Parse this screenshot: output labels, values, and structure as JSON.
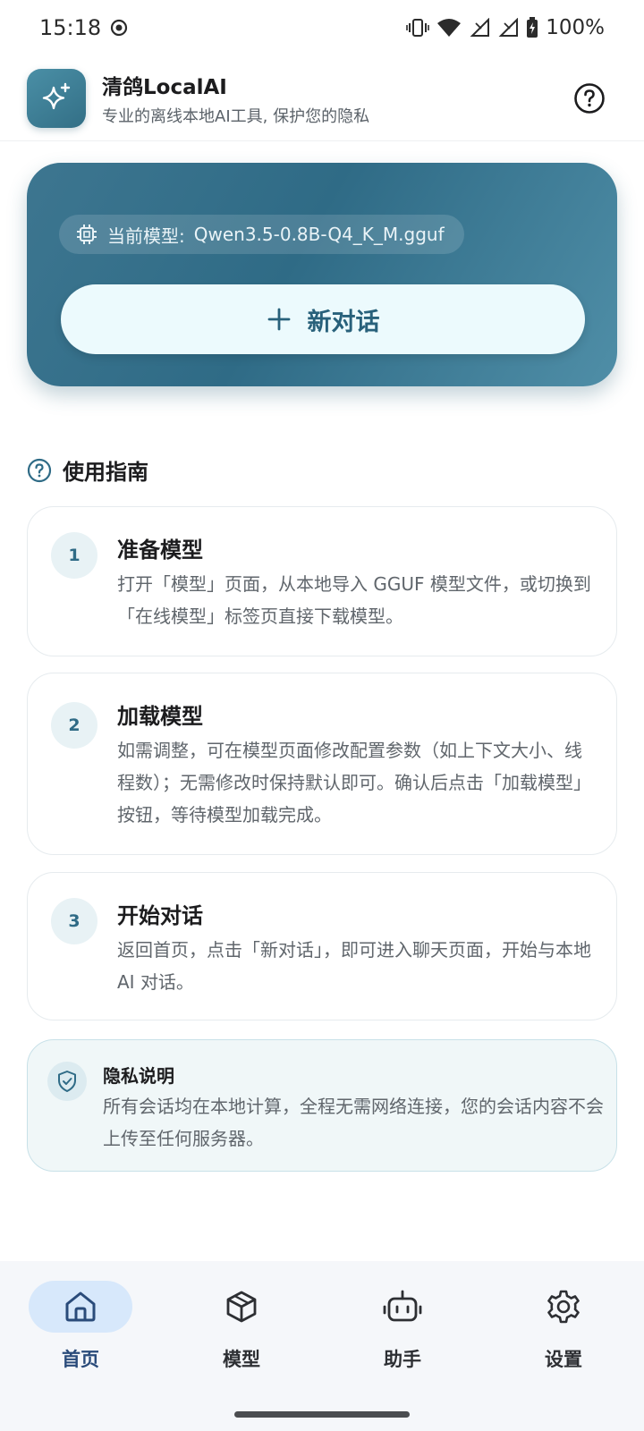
{
  "status_bar": {
    "time": "15:18",
    "battery": "100%",
    "icons": [
      "dnd-icon",
      "vibrate-icon",
      "wifi-icon",
      "signal-icon",
      "signal-icon",
      "battery-icon"
    ]
  },
  "header": {
    "title": "清鸽LocalAI",
    "subtitle": "专业的离线本地AI工具, 保护您的隐私",
    "logo_icon": "sparkle-icon",
    "help_icon": "help-circle-icon"
  },
  "hero": {
    "model_label": "当前模型:",
    "model_name": "Qwen3.5-0.8B-Q4_K_M.gguf",
    "new_chat_label": "新对话"
  },
  "guide": {
    "title": "使用指南",
    "steps": [
      {
        "num": "1",
        "title": "准备模型",
        "desc": "打开「模型」页面，从本地导入 GGUF 模型文件，或切换到「在线模型」标签页直接下载模型。"
      },
      {
        "num": "2",
        "title": "加载模型",
        "desc": "如需调整，可在模型页面修改配置参数（如上下文大小、线程数）；无需修改时保持默认即可。确认后点击「加载模型」按钮，等待模型加载完成。"
      },
      {
        "num": "3",
        "title": "开始对话",
        "desc": "返回首页，点击「新对话」，即可进入聊天页面，开始与本地 AI 对话。"
      }
    ]
  },
  "privacy": {
    "title": "隐私说明",
    "desc": "所有会话均在本地计算，全程无需网络连接，您的会话内容不会上传至任何服务器。"
  },
  "nav": {
    "items": [
      {
        "label": "首页",
        "icon": "home-icon",
        "active": true
      },
      {
        "label": "模型",
        "icon": "cube-icon",
        "active": false
      },
      {
        "label": "助手",
        "icon": "robot-icon",
        "active": false
      },
      {
        "label": "设置",
        "icon": "gear-icon",
        "active": false
      }
    ]
  },
  "colors": {
    "accent": "#2f6b86",
    "hero_bg": "#3d7690",
    "nav_active_bg": "#d7e8fb"
  }
}
